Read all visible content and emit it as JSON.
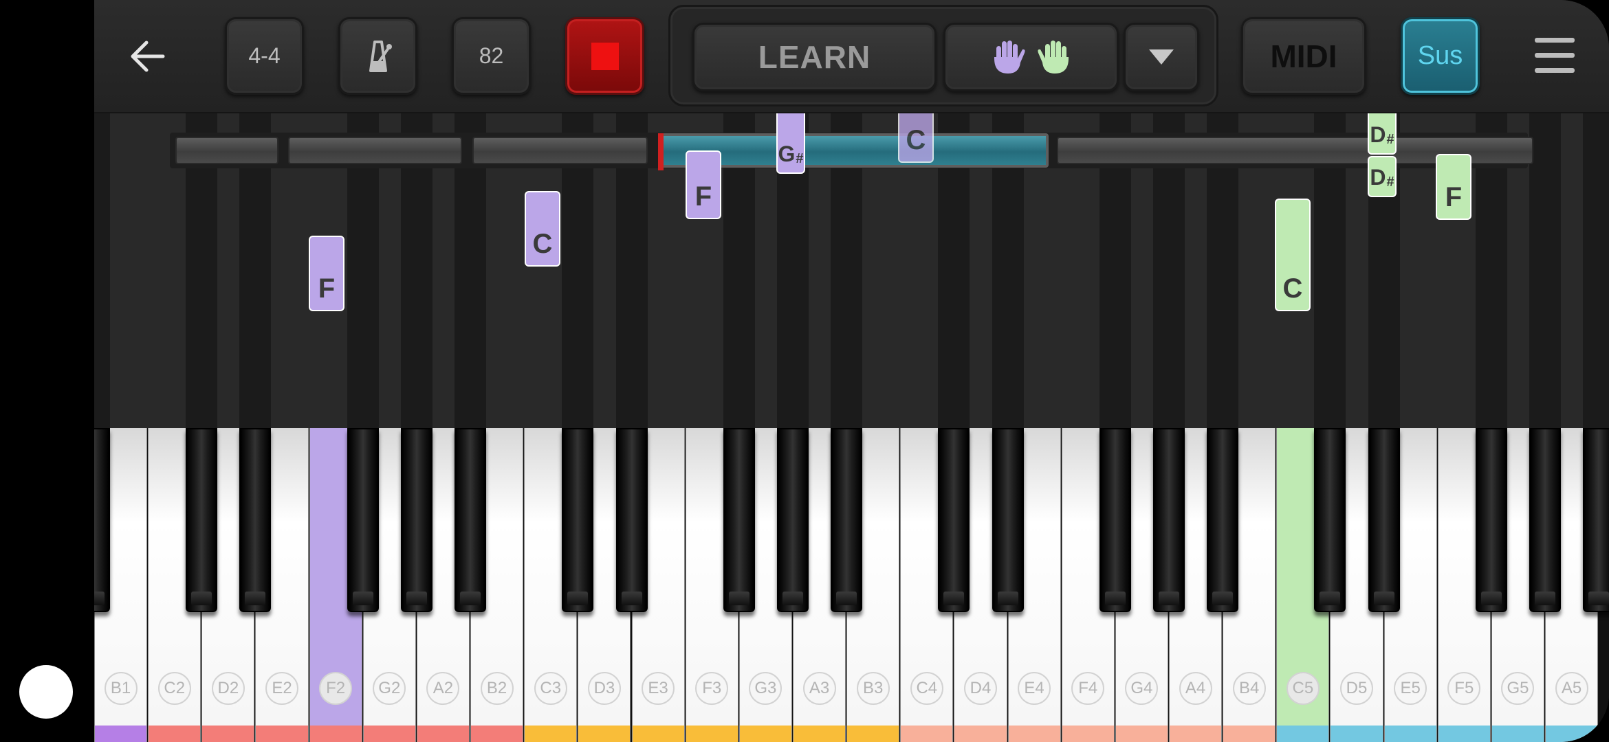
{
  "toolbar": {
    "time_signature": "4-4",
    "tempo": "82",
    "mode_label": "LEARN",
    "midi_label": "MIDI",
    "sustain_label": "Sus",
    "left_hand_color": "#bba6e8",
    "right_hand_color": "#bfeab3",
    "stop_color": "#ee1111",
    "sustain_color": "#5fd5ef",
    "icons": [
      "back-arrow-icon",
      "metronome-icon",
      "stop-icon",
      "left-hand-icon",
      "right-hand-icon",
      "chevron-down-icon",
      "hamburger-menu-icon"
    ]
  },
  "progress": {
    "segments": 5,
    "active_segment": 4
  },
  "falling_notes": [
    {
      "name": "F",
      "accidental": "",
      "hand": "left"
    },
    {
      "name": "C",
      "accidental": "",
      "hand": "left"
    },
    {
      "name": "F",
      "accidental": "",
      "hand": "left"
    },
    {
      "name": "G",
      "accidental": "#",
      "hand": "left"
    },
    {
      "name": "C",
      "accidental": "",
      "hand": "left"
    },
    {
      "name": "C",
      "accidental": "",
      "hand": "right"
    },
    {
      "name": "D",
      "accidental": "#",
      "hand": "right"
    },
    {
      "name": "D",
      "accidental": "#",
      "hand": "right"
    },
    {
      "name": "F",
      "accidental": "",
      "hand": "right"
    }
  ],
  "keyboard": {
    "white_keys": [
      {
        "label": "B1",
        "band": "#b57fe6"
      },
      {
        "label": "C2",
        "band": "#f37d78"
      },
      {
        "label": "D2",
        "band": "#f37d78"
      },
      {
        "label": "E2",
        "band": "#f37d78"
      },
      {
        "label": "F2",
        "band": "#f37d78",
        "pressed": "left"
      },
      {
        "label": "G2",
        "band": "#f37d78"
      },
      {
        "label": "A2",
        "band": "#f37d78"
      },
      {
        "label": "B2",
        "band": "#f37d78"
      },
      {
        "label": "C3",
        "band": "#f9bd39"
      },
      {
        "label": "D3",
        "band": "#f9bd39"
      },
      {
        "label": "E3",
        "band": "#f9bd39"
      },
      {
        "label": "F3",
        "band": "#f9bd39"
      },
      {
        "label": "G3",
        "band": "#f9bd39"
      },
      {
        "label": "A3",
        "band": "#f9bd39"
      },
      {
        "label": "B3",
        "band": "#f9bd39"
      },
      {
        "label": "C4",
        "band": "#f8b09a"
      },
      {
        "label": "D4",
        "band": "#f8b09a"
      },
      {
        "label": "E4",
        "band": "#f8b09a"
      },
      {
        "label": "F4",
        "band": "#f8b09a"
      },
      {
        "label": "G4",
        "band": "#f8b09a"
      },
      {
        "label": "A4",
        "band": "#f8b09a"
      },
      {
        "label": "B4",
        "band": "#f8b09a"
      },
      {
        "label": "C5",
        "band": "#73c8e1",
        "pressed": "right"
      },
      {
        "label": "D5",
        "band": "#73c8e1"
      },
      {
        "label": "E5",
        "band": "#73c8e1"
      },
      {
        "label": "F5",
        "band": "#73c8e1"
      },
      {
        "label": "G5",
        "band": "#73c8e1"
      },
      {
        "label": "A5",
        "band": "#73c8e1"
      }
    ]
  }
}
